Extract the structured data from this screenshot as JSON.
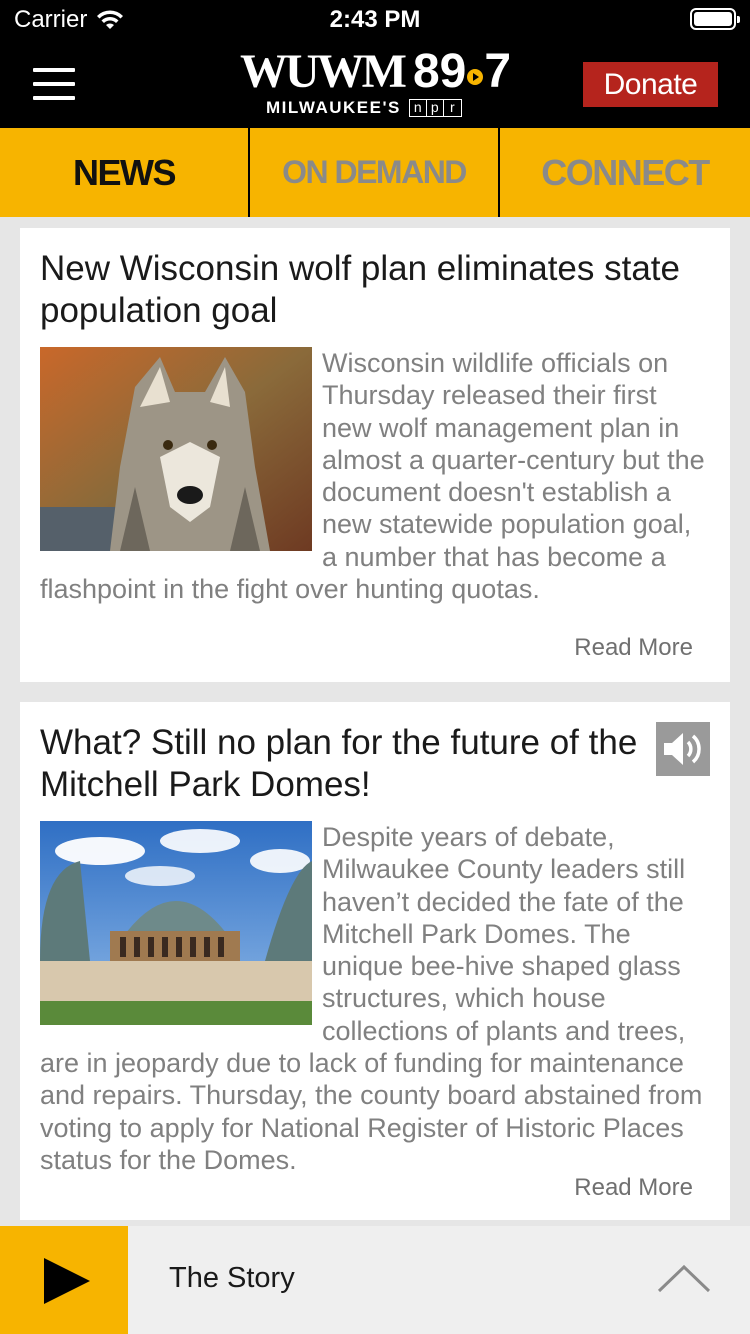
{
  "status_bar": {
    "carrier": "Carrier",
    "time": "2:43 PM"
  },
  "header": {
    "logo_call": "WUWM",
    "logo_freq_a": "89",
    "logo_freq_b": "7",
    "logo_sub": "MILWAUKEE'S",
    "npr_letters": [
      "n",
      "p",
      "r"
    ],
    "donate_label": "Donate"
  },
  "tabs": [
    {
      "label": "NEWS",
      "active": true
    },
    {
      "label": "ON DEMAND",
      "active": false
    },
    {
      "label": "CONNECT",
      "active": false
    }
  ],
  "stories": [
    {
      "title": "New Wisconsin wolf plan eliminates state population goal",
      "excerpt": "Wisconsin wildlife officials on Thursday released their first new wolf management plan in almost a quarter-century but the document doesn't establish a new statewide population goal, a number that has become a flashpoint in the fight over hunting quotas.",
      "read_more": "Read More",
      "image": "gray-wolf-photo",
      "has_audio": false
    },
    {
      "title": "What? Still no plan for the future of the Mitchell Park Domes!",
      "excerpt": "Despite years of debate, Milwaukee County leaders still haven’t decided the fate of the Mitchell Park Domes. The unique bee-hive shaped glass structures, which house collections of plants and trees, are in jeopardy due to lack of funding for maintenance and repairs. Thursday, the county board abstained from voting to apply for National Register of Historic Places status for the Domes.",
      "read_more": "Read More",
      "image": "mitchell-park-domes-photo",
      "has_audio": true
    }
  ],
  "player": {
    "now_playing": "The Story",
    "play_icon": "play-icon",
    "expand_icon": "chevron-up-icon"
  },
  "colors": {
    "accent": "#f7b400",
    "donate": "#b5241d",
    "header_bg": "#000000",
    "excerpt_text": "#808080"
  }
}
